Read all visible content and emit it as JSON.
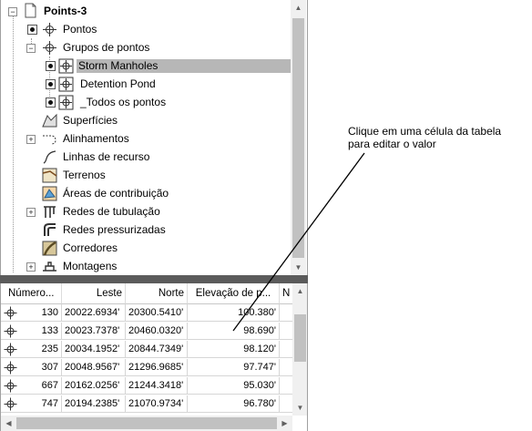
{
  "tree": {
    "root": "Points-3",
    "nodes": [
      {
        "label": "Pontos"
      },
      {
        "label": "Grupos de pontos"
      },
      {
        "label": "Storm Manholes"
      },
      {
        "label": "Detention Pond"
      },
      {
        "label": "_Todos os pontos"
      },
      {
        "label": "Superfícies"
      },
      {
        "label": "Alinhamentos"
      },
      {
        "label": "Linhas de recurso"
      },
      {
        "label": "Terrenos"
      },
      {
        "label": "Áreas de contribuição"
      },
      {
        "label": "Redes de tubulação"
      },
      {
        "label": "Redes pressurizadas"
      },
      {
        "label": "Corredores"
      },
      {
        "label": "Montagens"
      }
    ]
  },
  "grid": {
    "columns": [
      "Número...",
      "Leste",
      "Norte",
      "Elevação de p...",
      "N"
    ],
    "rows": [
      {
        "numero": "130",
        "leste": "20022.6934'",
        "norte": "20300.5410'",
        "elevacao": "100.380'"
      },
      {
        "numero": "133",
        "leste": "20023.7378'",
        "norte": "20460.0320'",
        "elevacao": "98.690'"
      },
      {
        "numero": "235",
        "leste": "20034.1952'",
        "norte": "20844.7349'",
        "elevacao": "98.120'"
      },
      {
        "numero": "307",
        "leste": "20048.9567'",
        "norte": "21296.9685'",
        "elevacao": "97.747'"
      },
      {
        "numero": "667",
        "leste": "20162.0256'",
        "norte": "21244.3418'",
        "elevacao": "95.030'"
      },
      {
        "numero": "747",
        "leste": "20194.2385'",
        "norte": "21070.9734'",
        "elevacao": "96.780'"
      }
    ]
  },
  "callout": {
    "line1": "Clique em uma célula da tabela",
    "line2": "para editar o valor"
  },
  "colors": {
    "selection": "#b7b7b7",
    "splitter": "#5b5b5b",
    "scrollbar_track": "#f0f0f0",
    "scrollbar_thumb": "#c1c1c1"
  }
}
